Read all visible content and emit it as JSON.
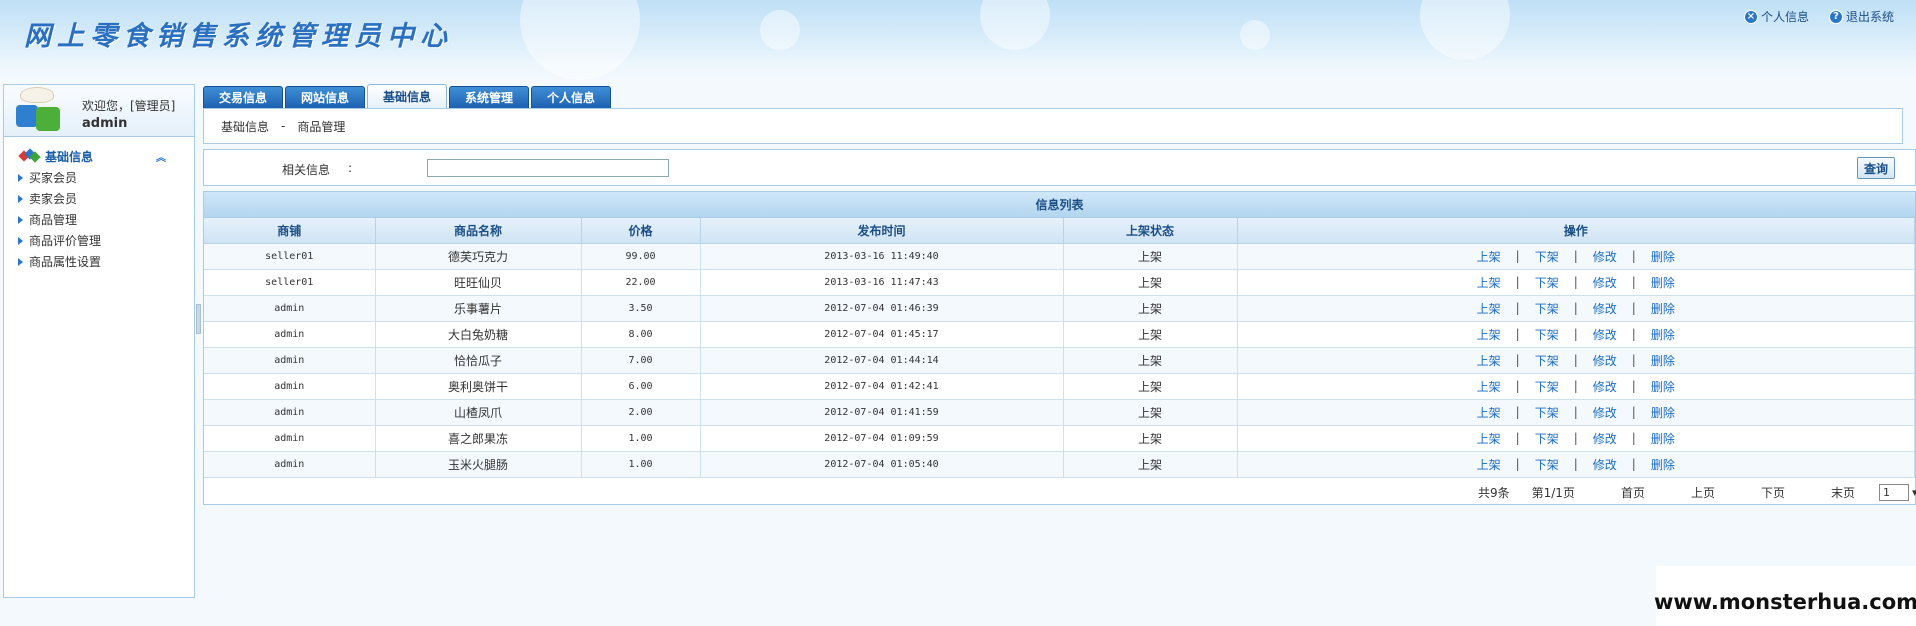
{
  "header": {
    "title": "网上零食销售系统管理员中心",
    "links": [
      {
        "icon": "x-circle-icon",
        "glyph": "×",
        "label": "个人信息"
      },
      {
        "icon": "help-circle-icon",
        "glyph": "?",
        "label": "退出系统"
      }
    ]
  },
  "sidebar": {
    "welcome": "欢迎您，[管理员]",
    "username": "admin",
    "section_title": "基础信息",
    "items": [
      {
        "label": "买家会员"
      },
      {
        "label": "卖家会员"
      },
      {
        "label": "商品管理"
      },
      {
        "label": "商品评价管理"
      },
      {
        "label": "商品属性设置"
      }
    ]
  },
  "tabs": [
    {
      "label": "交易信息",
      "active": false
    },
    {
      "label": "网站信息",
      "active": false
    },
    {
      "label": "基础信息",
      "active": true
    },
    {
      "label": "系统管理",
      "active": false
    },
    {
      "label": "个人信息",
      "active": false
    }
  ],
  "breadcrumb": {
    "section": "基础信息",
    "separator": "-",
    "page": "商品管理"
  },
  "search": {
    "label": "相关信息",
    "colon": ":",
    "value": "",
    "button": "查询"
  },
  "list": {
    "title": "信息列表",
    "columns": [
      "商铺",
      "商品名称",
      "价格",
      "发布时间",
      "上架状态",
      "操作"
    ],
    "actions": [
      "上架",
      "下架",
      "修改",
      "删除"
    ],
    "action_separator": "|",
    "rows": [
      {
        "shop": "seller01",
        "name": "德芙巧克力",
        "price": "99.00",
        "time": "2013-03-16 11:49:40",
        "status": "上架"
      },
      {
        "shop": "seller01",
        "name": "旺旺仙贝",
        "price": "22.00",
        "time": "2013-03-16 11:47:43",
        "status": "上架"
      },
      {
        "shop": "admin",
        "name": "乐事薯片",
        "price": "3.50",
        "time": "2012-07-04 01:46:39",
        "status": "上架"
      },
      {
        "shop": "admin",
        "name": "大白兔奶糖",
        "price": "8.00",
        "time": "2012-07-04 01:45:17",
        "status": "上架"
      },
      {
        "shop": "admin",
        "name": "恰恰瓜子",
        "price": "7.00",
        "time": "2012-07-04 01:44:14",
        "status": "上架"
      },
      {
        "shop": "admin",
        "name": "奥利奥饼干",
        "price": "6.00",
        "time": "2012-07-04 01:42:41",
        "status": "上架"
      },
      {
        "shop": "admin",
        "name": "山楂凤爪",
        "price": "2.00",
        "time": "2012-07-04 01:41:59",
        "status": "上架"
      },
      {
        "shop": "admin",
        "name": "喜之郎果冻",
        "price": "1.00",
        "time": "2012-07-04 01:09:59",
        "status": "上架"
      },
      {
        "shop": "admin",
        "name": "玉米火腿肠",
        "price": "1.00",
        "time": "2012-07-04 01:05:40",
        "status": "上架"
      }
    ]
  },
  "pager": {
    "total": "共9条",
    "page_info": "第1/1页",
    "first": "首页",
    "prev": "上页",
    "next": "下页",
    "last": "末页",
    "selected_page": "1"
  },
  "watermark": "www.monsterhua.com",
  "colors": {
    "accent": "#1d61b0",
    "link": "#1a6cc4",
    "border": "#a9cbe3"
  }
}
